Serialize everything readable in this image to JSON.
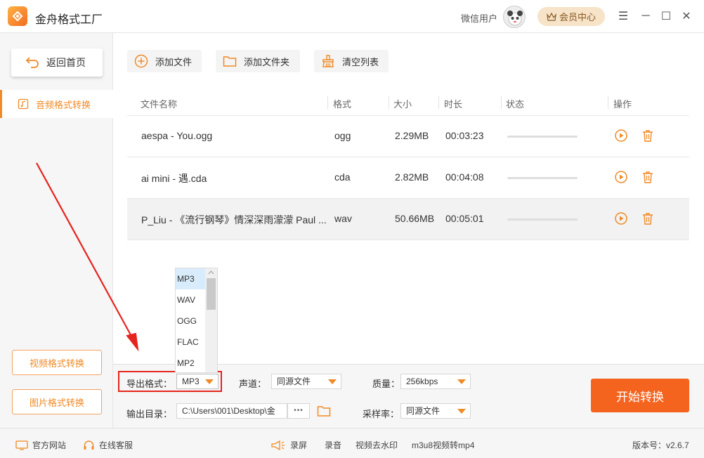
{
  "app": {
    "title": "金舟格式工厂"
  },
  "header": {
    "user_label": "微信用户",
    "vip_label": "会员中心",
    "controls": [
      "☰",
      "─",
      "☐",
      "✕"
    ]
  },
  "sidebar": {
    "home_label": "返回首页",
    "active_item": "音频格式转换",
    "video_label": "视频格式转换",
    "image_label": "图片格式转换"
  },
  "toolbar": {
    "add_file": "添加文件",
    "add_folder": "添加文件夹",
    "clear_list": "清空列表"
  },
  "table": {
    "headers": [
      "文件名称",
      "格式",
      "大小",
      "时长",
      "状态",
      "操作"
    ],
    "rows": [
      {
        "name": "aespa - You.ogg",
        "format": "ogg",
        "size": "2.29MB",
        "duration": "00:03:23"
      },
      {
        "name": "ai mini - 遇.cda",
        "format": "cda",
        "size": "2.82MB",
        "duration": "00:04:08"
      },
      {
        "name": "P_Liu - 《流行钢琴》情深深雨濛濛 Paul ...",
        "format": "wav",
        "size": "50.66MB",
        "duration": "00:05:01"
      }
    ]
  },
  "format_dropdown": {
    "options": [
      "MP3",
      "WAV",
      "OGG",
      "FLAC",
      "MP2"
    ],
    "selected": "MP3"
  },
  "settings": {
    "export_format_label": "导出格式：",
    "export_format_value": "MP3",
    "channel_label": "声道：",
    "channel_value": "同源文件",
    "quality_label": "质量：",
    "quality_value": "256kbps",
    "output_dir_label": "输出目录：",
    "output_dir_value": "C:\\Users\\001\\Desktop\\金",
    "more_label": "•••",
    "sample_rate_label": "采样率：",
    "sample_rate_value": "同源文件",
    "start_label": "开始转换"
  },
  "statusbar": {
    "website": "官方网站",
    "support": "在线客服",
    "record_screen": "录屏",
    "record_audio": "录音",
    "remove_watermark": "视频去水印",
    "m3u8": "m3u8视频转mp4",
    "version": "版本号：v2.6.7"
  },
  "colors": {
    "accent": "#f08a24",
    "start_button": "#f4641f",
    "annotation": "#e5241e"
  }
}
